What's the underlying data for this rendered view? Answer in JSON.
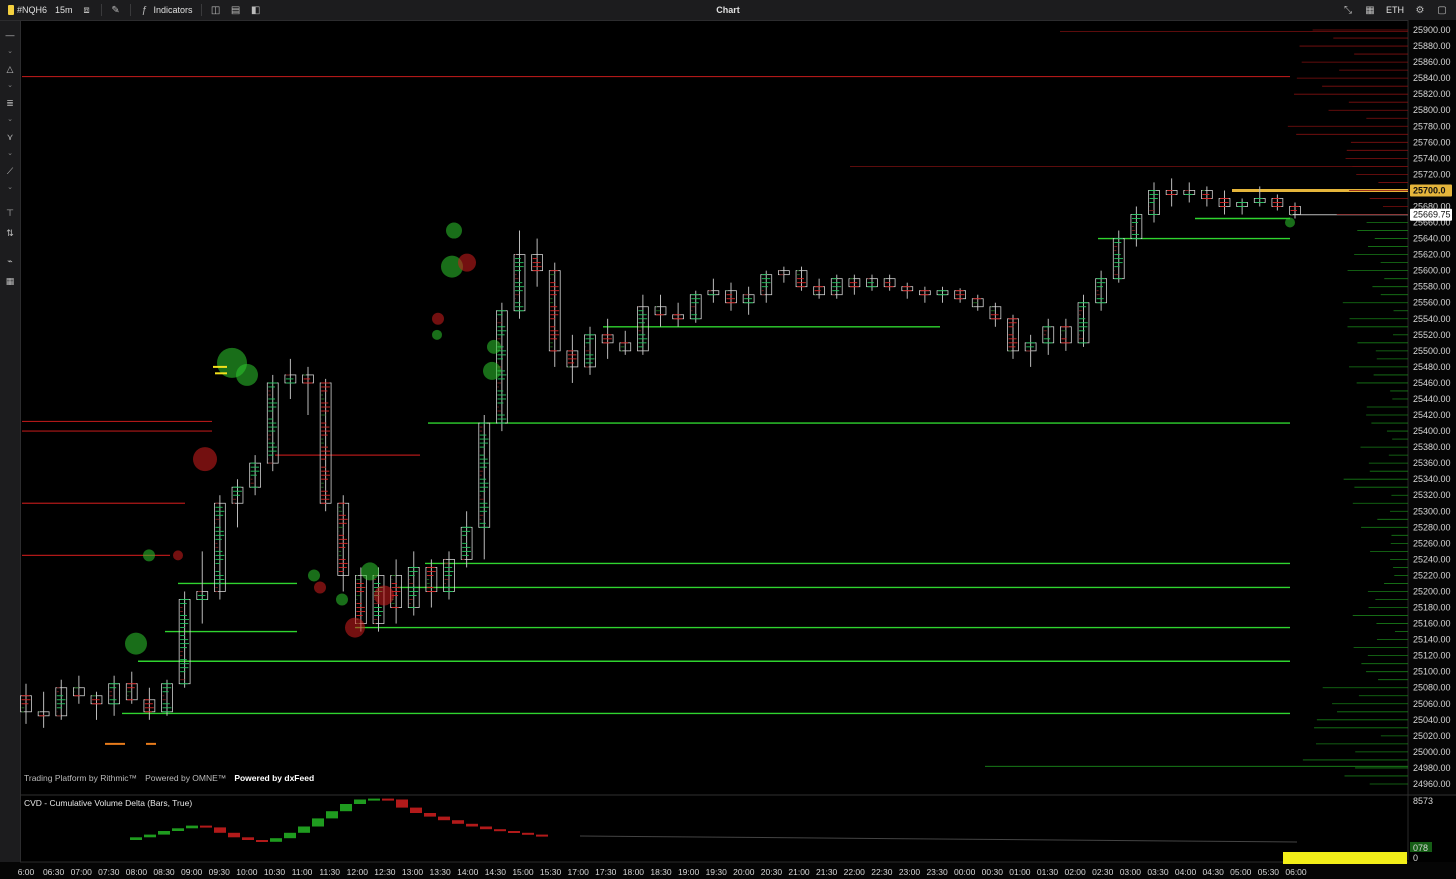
{
  "toolbar": {
    "symbol": "#NQH6",
    "timeframe": "15m",
    "indicators_label": "Indicators",
    "title": "Chart",
    "session": "ETH"
  },
  "price_axis": {
    "ticks": [
      "25900.00",
      "25880.00",
      "25860.00",
      "25840.00",
      "25820.00",
      "25800.00",
      "25780.00",
      "25760.00",
      "25740.00",
      "25720.00",
      "25700.00",
      "25680.00",
      "25660.00",
      "25640.00",
      "25620.00",
      "25600.00",
      "25580.00",
      "25560.00",
      "25540.00",
      "25520.00",
      "25500.00",
      "25480.00",
      "25460.00",
      "25440.00",
      "25420.00",
      "25400.00",
      "25380.00",
      "25360.00",
      "25340.00",
      "25320.00",
      "25300.00",
      "25280.00",
      "25260.00",
      "25240.00",
      "25220.00",
      "25200.00",
      "25180.00",
      "25160.00",
      "25140.00",
      "25120.00",
      "25100.00",
      "25080.00",
      "25060.00",
      "25040.00",
      "25020.00",
      "25000.00",
      "24980.00",
      "24960.00"
    ],
    "highlight_price": "25700.0",
    "last_price": "25669.75"
  },
  "time_axis": {
    "ticks": [
      "6:00",
      "06:30",
      "07:00",
      "07:30",
      "08:00",
      "08:30",
      "09:00",
      "09:30",
      "10:00",
      "10:30",
      "11:00",
      "11:30",
      "12:00",
      "12:30",
      "13:00",
      "13:30",
      "14:00",
      "14:30",
      "15:00",
      "15:30",
      "17:00",
      "17:30",
      "18:00",
      "18:30",
      "19:00",
      "19:30",
      "20:00",
      "20:30",
      "21:00",
      "21:30",
      "22:00",
      "22:30",
      "23:00",
      "23:30",
      "00:00",
      "00:30",
      "01:00",
      "01:30",
      "02:00",
      "02:30",
      "03:00",
      "03:30",
      "04:00",
      "04:30",
      "05:00",
      "05:30",
      "06:00"
    ]
  },
  "watermark": {
    "rithmic": "Trading Platform by Rithmic™",
    "omne": "Powered by OMNE™",
    "dxfeed": "Powered by dxFeed"
  },
  "cvd": {
    "label": "CVD - Cumulative Volume Delta (Bars, True)",
    "axis_top": "8573",
    "axis_bottom": "0",
    "axis_mid": "078"
  },
  "colors": {
    "background": "#000000",
    "bull": "#22c55e",
    "bear": "#dc2626",
    "level_green": "#2fd42f",
    "level_red": "#b01818",
    "price_highlight": "#e5b53b"
  },
  "chart_data": {
    "type": "candlestick",
    "ylim": [
      24950,
      25910
    ],
    "candles": [
      [
        25070,
        25085,
        25035,
        25050
      ],
      [
        25050,
        25075,
        25030,
        25045
      ],
      [
        25045,
        25090,
        25040,
        25080
      ],
      [
        25080,
        25095,
        25060,
        25070
      ],
      [
        25070,
        25075,
        25040,
        25060
      ],
      [
        25060,
        25095,
        25045,
        25085
      ],
      [
        25085,
        25100,
        25060,
        25065
      ],
      [
        25065,
        25080,
        25040,
        25050
      ],
      [
        25050,
        25090,
        25045,
        25085
      ],
      [
        25085,
        25200,
        25080,
        25190
      ],
      [
        25190,
        25250,
        25160,
        25200
      ],
      [
        25200,
        25320,
        25190,
        25310
      ],
      [
        25310,
        25340,
        25280,
        25330
      ],
      [
        25330,
        25370,
        25320,
        25360
      ],
      [
        25360,
        25470,
        25350,
        25460
      ],
      [
        25460,
        25490,
        25440,
        25470
      ],
      [
        25470,
        25480,
        25420,
        25460
      ],
      [
        25460,
        25465,
        25300,
        25310
      ],
      [
        25310,
        25320,
        25200,
        25220
      ],
      [
        25220,
        25230,
        25150,
        25160
      ],
      [
        25160,
        25230,
        25150,
        25220
      ],
      [
        25220,
        25240,
        25160,
        25180
      ],
      [
        25180,
        25250,
        25170,
        25230
      ],
      [
        25230,
        25240,
        25180,
        25200
      ],
      [
        25200,
        25250,
        25190,
        25240
      ],
      [
        25240,
        25300,
        25230,
        25280
      ],
      [
        25280,
        25420,
        25240,
        25410
      ],
      [
        25410,
        25560,
        25400,
        25550
      ],
      [
        25550,
        25650,
        25540,
        25620
      ],
      [
        25620,
        25640,
        25580,
        25600
      ],
      [
        25600,
        25610,
        25480,
        25500
      ],
      [
        25500,
        25520,
        25460,
        25480
      ],
      [
        25480,
        25530,
        25470,
        25520
      ],
      [
        25520,
        25540,
        25490,
        25510
      ],
      [
        25510,
        25525,
        25495,
        25500
      ],
      [
        25500,
        25570,
        25495,
        25555
      ],
      [
        25555,
        25570,
        25530,
        25545
      ],
      [
        25545,
        25560,
        25530,
        25540
      ],
      [
        25540,
        25575,
        25535,
        25570
      ],
      [
        25570,
        25590,
        25560,
        25575
      ],
      [
        25575,
        25585,
        25550,
        25560
      ],
      [
        25560,
        25580,
        25545,
        25570
      ],
      [
        25570,
        25600,
        25560,
        25595
      ],
      [
        25595,
        25605,
        25585,
        25600
      ],
      [
        25600,
        25605,
        25575,
        25580
      ],
      [
        25580,
        25590,
        25565,
        25570
      ],
      [
        25570,
        25595,
        25565,
        25590
      ],
      [
        25590,
        25595,
        25570,
        25580
      ],
      [
        25580,
        25595,
        25575,
        25590
      ],
      [
        25590,
        25595,
        25575,
        25580
      ],
      [
        25580,
        25585,
        25565,
        25575
      ],
      [
        25575,
        25580,
        25560,
        25570
      ],
      [
        25570,
        25580,
        25560,
        25575
      ],
      [
        25575,
        25578,
        25560,
        25565
      ],
      [
        25565,
        25570,
        25550,
        25555
      ],
      [
        25555,
        25560,
        25530,
        25540
      ],
      [
        25540,
        25545,
        25490,
        25500
      ],
      [
        25500,
        25520,
        25480,
        25510
      ],
      [
        25510,
        25540,
        25495,
        25530
      ],
      [
        25530,
        25540,
        25500,
        25510
      ],
      [
        25510,
        25570,
        25505,
        25560
      ],
      [
        25560,
        25600,
        25550,
        25590
      ],
      [
        25590,
        25650,
        25585,
        25640
      ],
      [
        25640,
        25680,
        25630,
        25670
      ],
      [
        25670,
        25710,
        25660,
        25700
      ],
      [
        25700,
        25715,
        25680,
        25695
      ],
      [
        25695,
        25710,
        25685,
        25700
      ],
      [
        25700,
        25705,
        25680,
        25690
      ],
      [
        25690,
        25700,
        25670,
        25680
      ],
      [
        25680,
        25690,
        25670,
        25685
      ],
      [
        25685,
        25705,
        25680,
        25690
      ],
      [
        25690,
        25695,
        25675,
        25680
      ],
      [
        25680,
        25685,
        25665,
        25670
      ]
    ]
  }
}
